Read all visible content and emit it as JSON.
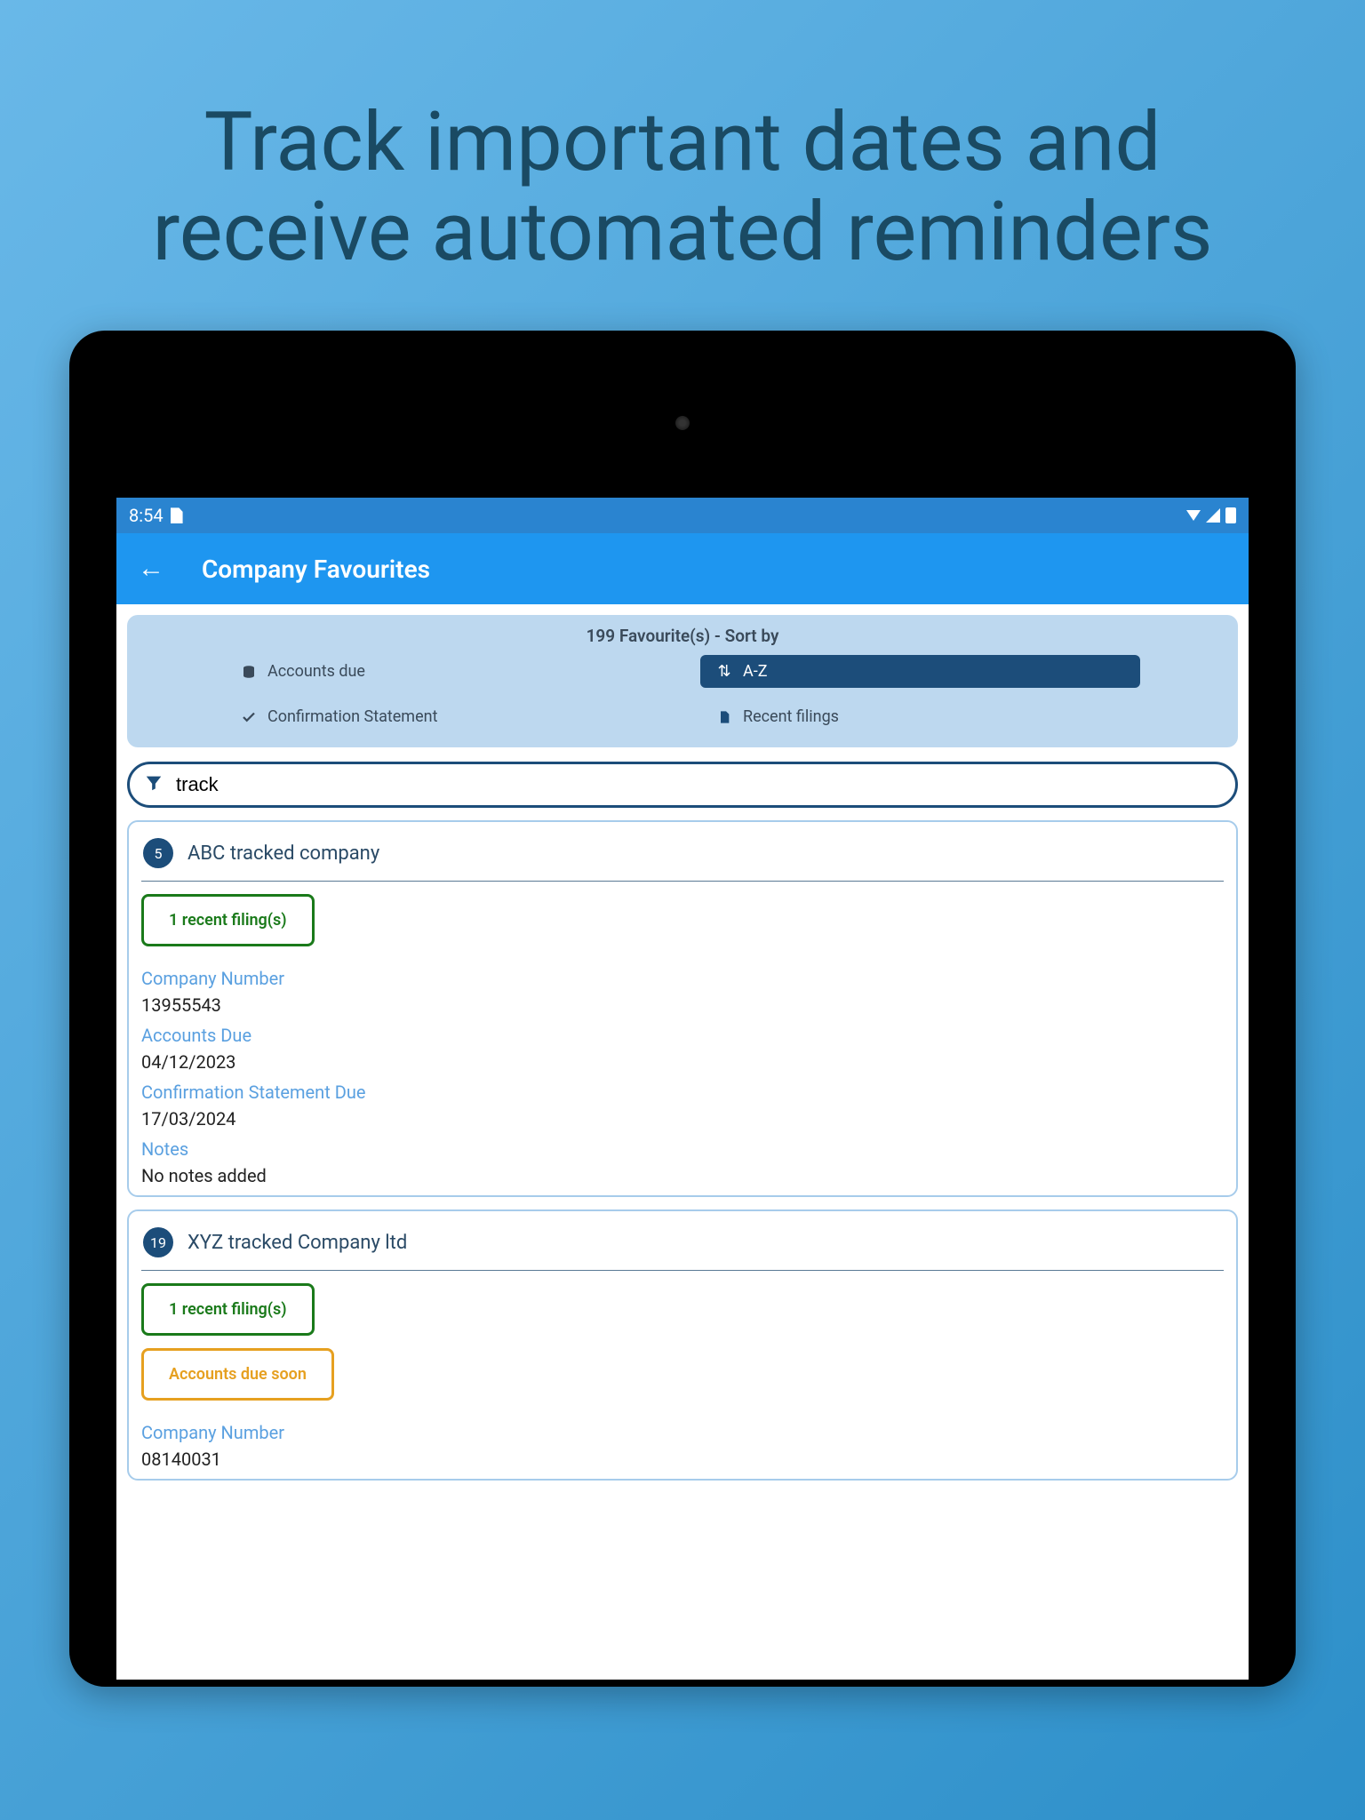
{
  "hero": "Track important dates and receive automated reminders",
  "statusbar": {
    "time": "8:54"
  },
  "appbar": {
    "title": "Company Favourites"
  },
  "sort": {
    "heading": "199 Favourite(s) - Sort by",
    "accounts_due": "Accounts due",
    "confirmation": "Confirmation Statement",
    "az": "A-Z",
    "recent": "Recent filings"
  },
  "filter": {
    "value": "track"
  },
  "cards": [
    {
      "count": "5",
      "name": "ABC tracked company",
      "chips": {
        "recent": "1 recent filing(s)"
      },
      "company_number_label": "Company Number",
      "company_number": "13955543",
      "accounts_due_label": "Accounts Due",
      "accounts_due": "04/12/2023",
      "confirmation_label": "Confirmation Statement Due",
      "confirmation": "17/03/2024",
      "notes_label": "Notes",
      "notes": "No notes added"
    },
    {
      "count": "19",
      "name": "XYZ  tracked Company ltd",
      "chips": {
        "recent": "1 recent filing(s)",
        "accounts_soon": "Accounts due soon"
      },
      "company_number_label": "Company Number",
      "company_number": "08140031"
    }
  ]
}
